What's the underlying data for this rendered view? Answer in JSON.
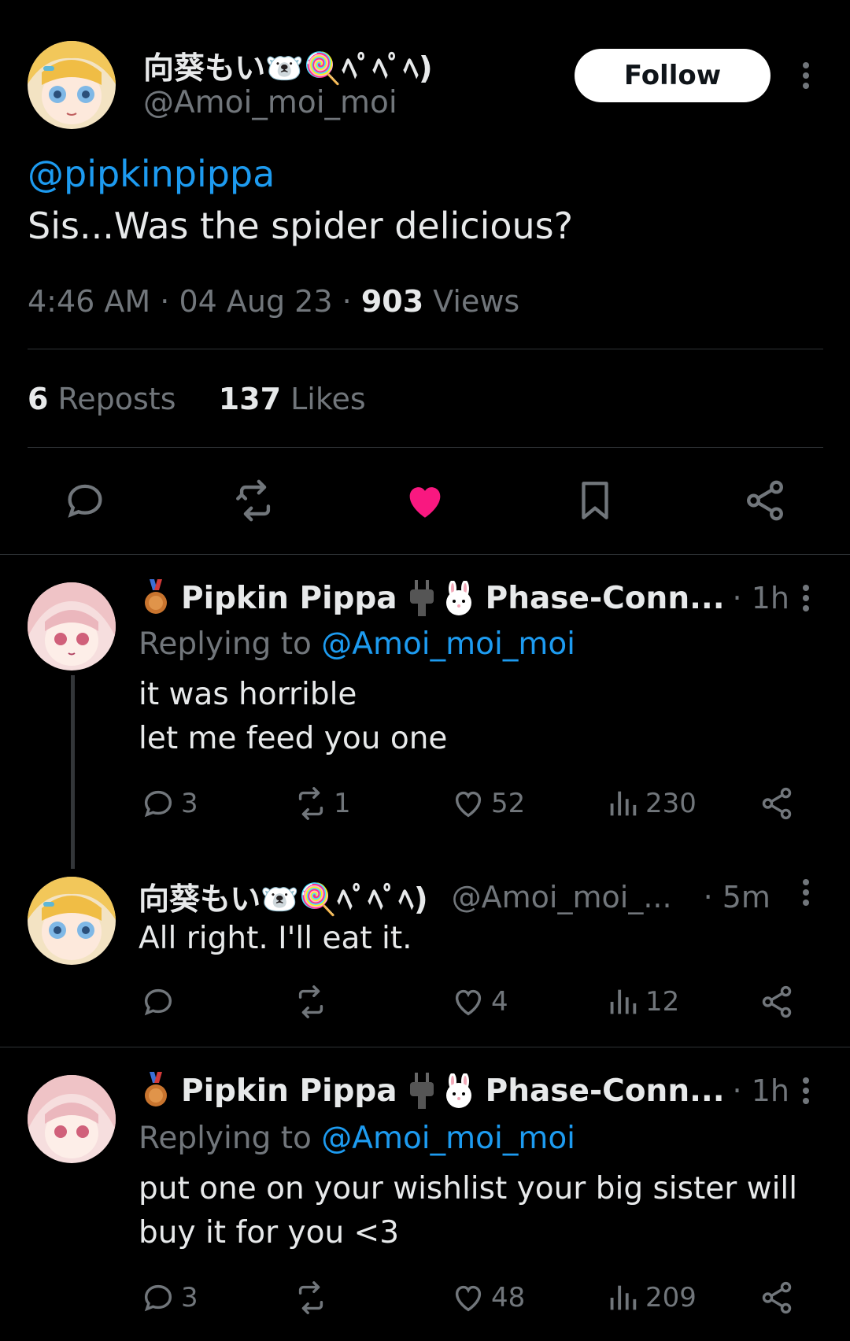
{
  "main_tweet": {
    "display_name": "向葵もい🐻‍❄️🍭ﾍﾟﾍﾟﾍ)",
    "handle": "@Amoi_moi_moi",
    "follow_label": "Follow",
    "mention": "@pipkinpippa",
    "text": "Sis...Was the spider delicious?",
    "time": "4:46 AM",
    "date": "04 Aug 23",
    "views_count": "903",
    "views_label": "Views",
    "reposts_count": "6",
    "reposts_label": "Reposts",
    "likes_count": "137",
    "likes_label": "Likes",
    "accent_like": "#f91880"
  },
  "replies": [
    {
      "display_name": "Pipkin Pippa",
      "affiliation": "Phase-Conn...",
      "time": "· 1h",
      "replying_prefix": "Replying to",
      "replying_handle": "@Amoi_moi_moi",
      "line1": "it was horrible",
      "line2": "let me feed you one",
      "replies": "3",
      "reposts": "1",
      "likes": "52",
      "views": "230"
    },
    {
      "display_name": "向葵もい🐻‍❄️🍭ﾍﾟﾍﾟﾍ)",
      "handle": "@Amoi_moi_...",
      "time": "· 5m",
      "line1": "All right. I'll eat it.",
      "likes": "4",
      "views": "12"
    },
    {
      "display_name": "Pipkin Pippa",
      "affiliation": "Phase-Conn...",
      "time": "· 1h",
      "replying_prefix": "Replying to",
      "replying_handle": "@Amoi_moi_moi",
      "line1": "put one on your wishlist your big sister will",
      "line2": "buy it for you <3",
      "replies": "3",
      "likes": "48",
      "views": "209"
    }
  ]
}
